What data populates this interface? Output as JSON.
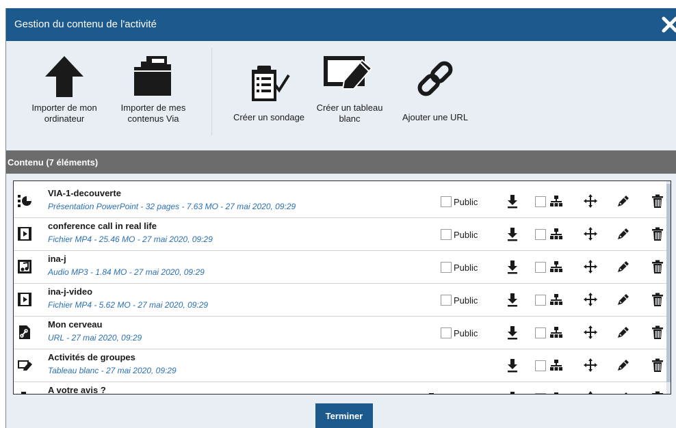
{
  "window": {
    "title": "Gestion du contenu de l'activité",
    "close_icon": "close-icon"
  },
  "toolbar": {
    "import_computer": {
      "label": "Importer de mon ordinateur",
      "icon": "upload-arrow-icon"
    },
    "import_via": {
      "label": "Importer de mes contenus Via",
      "icon": "folder-icon"
    },
    "create_poll": {
      "label": "Créer un sondage",
      "icon": "clipboard-check-icon"
    },
    "create_whiteboard": {
      "label": "Créer un tableau blanc",
      "icon": "whiteboard-icon"
    },
    "add_url": {
      "label": "Ajouter une URL",
      "icon": "link-icon"
    }
  },
  "content": {
    "header": "Contenu (7 éléments)",
    "public_label": "Public",
    "results_label": "Résultats",
    "items": [
      {
        "name": "VIA-1-decouverte",
        "meta": "Présentation PowerPoint - 32 pages - 7.63 MO - 27 mai 2020, 09:29",
        "type_icon": "presentation-icon",
        "public": false,
        "show_public": true,
        "show_results": false
      },
      {
        "name": "conference call in real life",
        "meta": "Fichier MP4 - 25.46 MO - 27 mai 2020, 09:29",
        "type_icon": "video-file-icon",
        "public": false,
        "show_public": true,
        "show_results": false
      },
      {
        "name": "ina-j",
        "meta": "Audio MP3 - 1.84 MO - 27 mai 2020, 09:29",
        "type_icon": "audio-file-icon",
        "public": false,
        "show_public": true,
        "show_results": false
      },
      {
        "name": "ina-j-video",
        "meta": "Fichier MP4 - 5.62 MO - 27 mai 2020, 09:29",
        "type_icon": "video-file-icon",
        "public": false,
        "show_public": true,
        "show_results": false
      },
      {
        "name": "Mon cerveau",
        "meta": "URL - 27 mai 2020, 09:29",
        "type_icon": "url-file-icon",
        "public": false,
        "show_public": true,
        "show_results": false
      },
      {
        "name": "Activités de groupes",
        "meta": "Tableau blanc - 27 mai 2020, 09:29",
        "type_icon": "whiteboard-icon",
        "public": false,
        "show_public": false,
        "show_results": false
      },
      {
        "name": "A votre avis ?",
        "meta": "",
        "type_icon": "poll-icon",
        "public": false,
        "show_public": false,
        "show_results": true
      }
    ],
    "row_actions": [
      "download-icon",
      "hierarchy-icon",
      "move-icon",
      "edit-icon",
      "delete-icon"
    ]
  },
  "footer": {
    "finish_label": "Terminer"
  },
  "colors": {
    "title_bar": "#1c5a8e",
    "section_bar": "#6c6c6c",
    "meta_text": "#2a6fb6",
    "background": "#e9eef5"
  }
}
